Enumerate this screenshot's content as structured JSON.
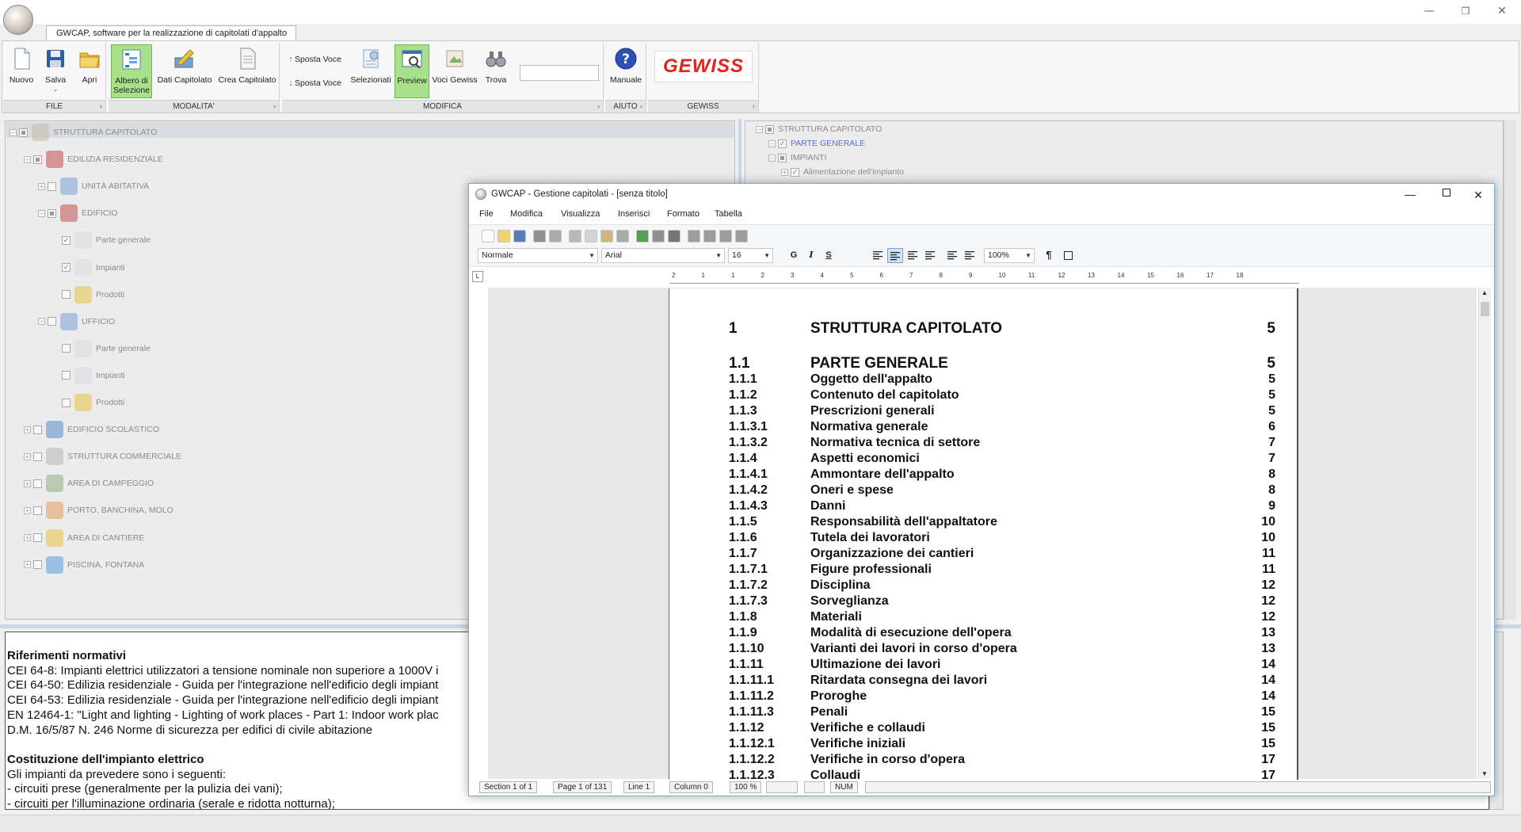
{
  "titlebar": {
    "minimize": "—",
    "restore": "❐",
    "close": "✕"
  },
  "tab": {
    "label": "GWCAP, software per la realizzazione di capitolati d'appalto"
  },
  "ribbon": {
    "groups": {
      "file": "FILE",
      "modalita": "MODALITA'",
      "modifica": "MODIFICA",
      "aiuto": "AIUTO",
      "gewiss": "GEWISS"
    },
    "buttons": {
      "nuovo": "Nuovo",
      "salva": "Salva",
      "apri": "Apri",
      "albero": "Albero di Selezione",
      "dati": "Dati Capitolato",
      "crea": "Crea Capitolato",
      "sposta_su": "Sposta Voce",
      "sposta_giu": "Sposta Voce",
      "selezionati": "Selezionati",
      "preview": "Preview",
      "voci_gewiss": "Voci Gewiss",
      "trova": "Trova",
      "manuale": "Manuale"
    },
    "search_value": "",
    "logo": "GEWISS"
  },
  "left_tree": [
    {
      "label": "STRUTTURA CAPITOLATO"
    },
    {
      "label": "EDILIZIA RESIDENZIALE"
    },
    {
      "label": "UNITÀ ABITATIVA"
    },
    {
      "label": "EDIFICIO"
    },
    {
      "label": "Parte generale"
    },
    {
      "label": "Impianti"
    },
    {
      "label": "Prodotti"
    },
    {
      "label": "UFFICIO"
    },
    {
      "label": "Parte generale"
    },
    {
      "label": "Impianti"
    },
    {
      "label": "Prodotti"
    },
    {
      "label": "EDIFICIO SCOLASTICO"
    },
    {
      "label": "STRUTTURA COMMERCIALE"
    },
    {
      "label": "AREA DI CAMPEGGIO"
    },
    {
      "label": "PORTO, BANCHINA, MOLO"
    },
    {
      "label": "AREA DI CANTIERE"
    },
    {
      "label": "PISCINA, FONTANA"
    }
  ],
  "right_tree": [
    {
      "label": "STRUTTURA CAPITOLATO"
    },
    {
      "label": "PARTE GENERALE"
    },
    {
      "label": "IMPIANTI"
    },
    {
      "label": "Alimentazione dell'impianto"
    }
  ],
  "notes": {
    "lines": [
      "Riferimenti normativi",
      "CEI 64-8: Impianti elettrici utilizzatori a tensione nominale non superiore a 1000V i",
      "CEI 64-50: Edilizia residenziale - Guida per l'integrazione nell'edificio degli impiant",
      "CEI 64-53: Edilizia residenziale - Guida per l'integrazione nell'edificio degli impiant",
      "EN 12464-1: \"Light and lighting - Lighting of work places - Part 1: Indoor work plac",
      "D.M. 16/5/87 N. 246 Norme di sicurezza per edifici di civile abitazione",
      "",
      "Costituzione dell'impianto elettrico",
      "Gli impianti da prevedere sono i seguenti:",
      "- circuiti prese (generalmente per la pulizia dei vani);",
      "- circuiti per l'illuminazione ordinaria (serale e ridotta notturna);"
    ]
  },
  "doc_window": {
    "title": "GWCAP - Gestione capitolati - [senza titolo]",
    "menu": [
      "File",
      "Modifica",
      "Visualizza",
      "Inserisci",
      "Formato",
      "Tabella"
    ],
    "style_combo": "Normale",
    "font_combo": "Arial",
    "size_combo": "16",
    "zoom_combo": "100%",
    "format_buttons": {
      "bold": "G",
      "italic": "I",
      "underline": "S"
    },
    "ruler_numbers": [
      "2",
      "1",
      "1",
      "2",
      "3",
      "4",
      "5",
      "6",
      "7",
      "8",
      "9",
      "10",
      "11",
      "12",
      "13",
      "14",
      "15",
      "16",
      "17",
      "18"
    ],
    "toc": [
      {
        "num": "1",
        "title": "STRUTTURA CAPITOLATO",
        "page": "5"
      },
      {
        "num": "1.1",
        "title": "PARTE GENERALE",
        "page": "5"
      },
      {
        "num": "1.1.1",
        "title": "Oggetto dell'appalto",
        "page": "5"
      },
      {
        "num": "1.1.2",
        "title": "Contenuto del capitolato",
        "page": "5"
      },
      {
        "num": "1.1.3",
        "title": "Prescrizioni generali",
        "page": "5"
      },
      {
        "num": "1.1.3.1",
        "title": "Normativa generale",
        "page": "6"
      },
      {
        "num": "1.1.3.2",
        "title": "Normativa tecnica di settore",
        "page": "7"
      },
      {
        "num": "1.1.4",
        "title": "Aspetti economici",
        "page": "7"
      },
      {
        "num": "1.1.4.1",
        "title": "Ammontare dell'appalto",
        "page": "8"
      },
      {
        "num": "1.1.4.2",
        "title": "Oneri e spese",
        "page": "8"
      },
      {
        "num": "1.1.4.3",
        "title": "Danni",
        "page": "9"
      },
      {
        "num": "1.1.5",
        "title": "Responsabilità dell'appaltatore",
        "page": "10"
      },
      {
        "num": "1.1.6",
        "title": "Tutela dei lavoratori",
        "page": "10"
      },
      {
        "num": "1.1.7",
        "title": "Organizzazione dei cantieri",
        "page": "11"
      },
      {
        "num": "1.1.7.1",
        "title": "Figure professionali",
        "page": "11"
      },
      {
        "num": "1.1.7.2",
        "title": "Disciplina",
        "page": "12"
      },
      {
        "num": "1.1.7.3",
        "title": "Sorveglianza",
        "page": "12"
      },
      {
        "num": "1.1.8",
        "title": "Materiali",
        "page": "12"
      },
      {
        "num": "1.1.9",
        "title": "Modalità di esecuzione dell'opera",
        "page": "13"
      },
      {
        "num": "1.1.10",
        "title": "Varianti dei lavori in corso d'opera",
        "page": "13"
      },
      {
        "num": "1.1.11",
        "title": "Ultimazione dei lavori",
        "page": "14"
      },
      {
        "num": "1.1.11.1",
        "title": "Ritardata consegna dei lavori",
        "page": "14"
      },
      {
        "num": "1.1.11.2",
        "title": "Proroghe",
        "page": "14"
      },
      {
        "num": "1.1.11.3",
        "title": "Penali",
        "page": "15"
      },
      {
        "num": "1.1.12",
        "title": "Verifiche e collaudi",
        "page": "15"
      },
      {
        "num": "1.1.12.1",
        "title": "Verifiche iniziali",
        "page": "15"
      },
      {
        "num": "1.1.12.2",
        "title": "Verifiche in corso d'opera",
        "page": "17"
      },
      {
        "num": "1.1.12.3",
        "title": "Collaudi",
        "page": "17"
      }
    ],
    "status": {
      "section": "Section 1 of 1",
      "page": "Page 1 of 131",
      "line": "Line 1",
      "column": "Column 0",
      "zoom": "100 %",
      "num": "NUM"
    }
  }
}
